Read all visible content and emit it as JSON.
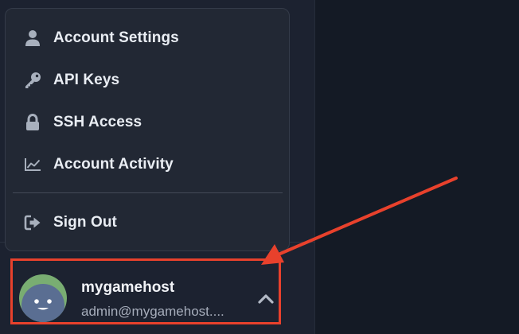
{
  "menu": {
    "items": [
      {
        "label": "Account Settings",
        "icon": "user-icon"
      },
      {
        "label": "API Keys",
        "icon": "key-icon"
      },
      {
        "label": "SSH Access",
        "icon": "lock-icon"
      },
      {
        "label": "Account Activity",
        "icon": "chart-line-icon"
      },
      {
        "label": "Sign Out",
        "icon": "sign-out-icon"
      }
    ]
  },
  "user": {
    "name": "mygamehost",
    "email": "admin@mygamehost...."
  },
  "colors": {
    "background": "#141a25",
    "sidebar": "#1c2230",
    "menu": "#222834",
    "annotation": "#e8412c",
    "avatar_top": "#79ad72",
    "avatar_face": "#5a6e92"
  }
}
